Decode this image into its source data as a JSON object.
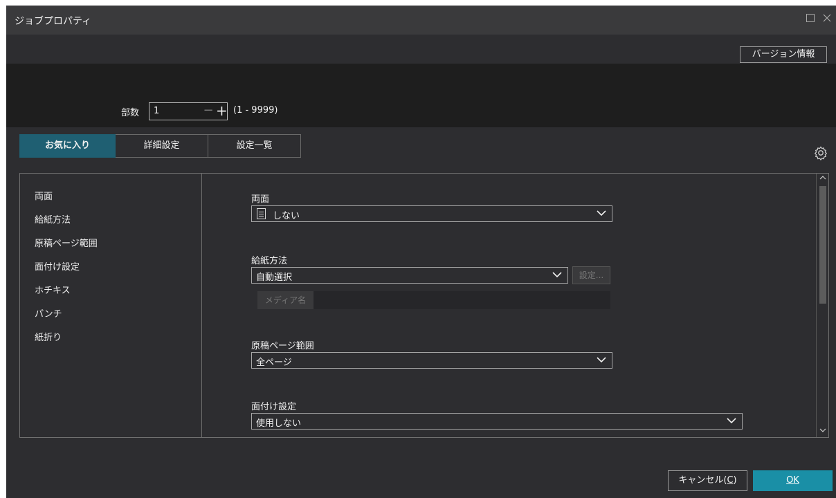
{
  "window": {
    "title": "ジョブプロパティ",
    "maximize_icon": "maximize-icon",
    "close_icon": "close-icon"
  },
  "toolbar": {
    "version_label": "バージョン情報"
  },
  "copies": {
    "label": "部数",
    "value": "1",
    "range": "(1 - 9999)"
  },
  "tabs": [
    {
      "label": "お気に入り",
      "active": true
    },
    {
      "label": "詳細設定",
      "active": false
    },
    {
      "label": "設定一覧",
      "active": false
    }
  ],
  "gear_icon": "gear-icon",
  "sidebar": {
    "items": [
      {
        "label": "両面"
      },
      {
        "label": "給紙方法"
      },
      {
        "label": "原稿ページ範囲"
      },
      {
        "label": "面付け設定"
      },
      {
        "label": "ホチキス"
      },
      {
        "label": "パンチ"
      },
      {
        "label": "紙折り"
      }
    ]
  },
  "sections": {
    "duplex": {
      "label": "両面",
      "value": "しない",
      "icon": "document-icon"
    },
    "paper_source": {
      "label": "給紙方法",
      "value": "自動選択",
      "settings_label": "設定...",
      "media_label": "メディア名"
    },
    "page_range": {
      "label": "原稿ページ範囲",
      "value": "全ページ"
    },
    "imposition": {
      "label": "面付け設定",
      "value": "使用しない"
    }
  },
  "footer": {
    "cancel_text": "キャンセル(",
    "cancel_key": "C",
    "cancel_end": ")",
    "ok_key": "O",
    "ok_rest": "K"
  },
  "colors": {
    "accent": "#1a8fa6",
    "tab_active": "#1f5f72",
    "background": "#2d2d30"
  }
}
